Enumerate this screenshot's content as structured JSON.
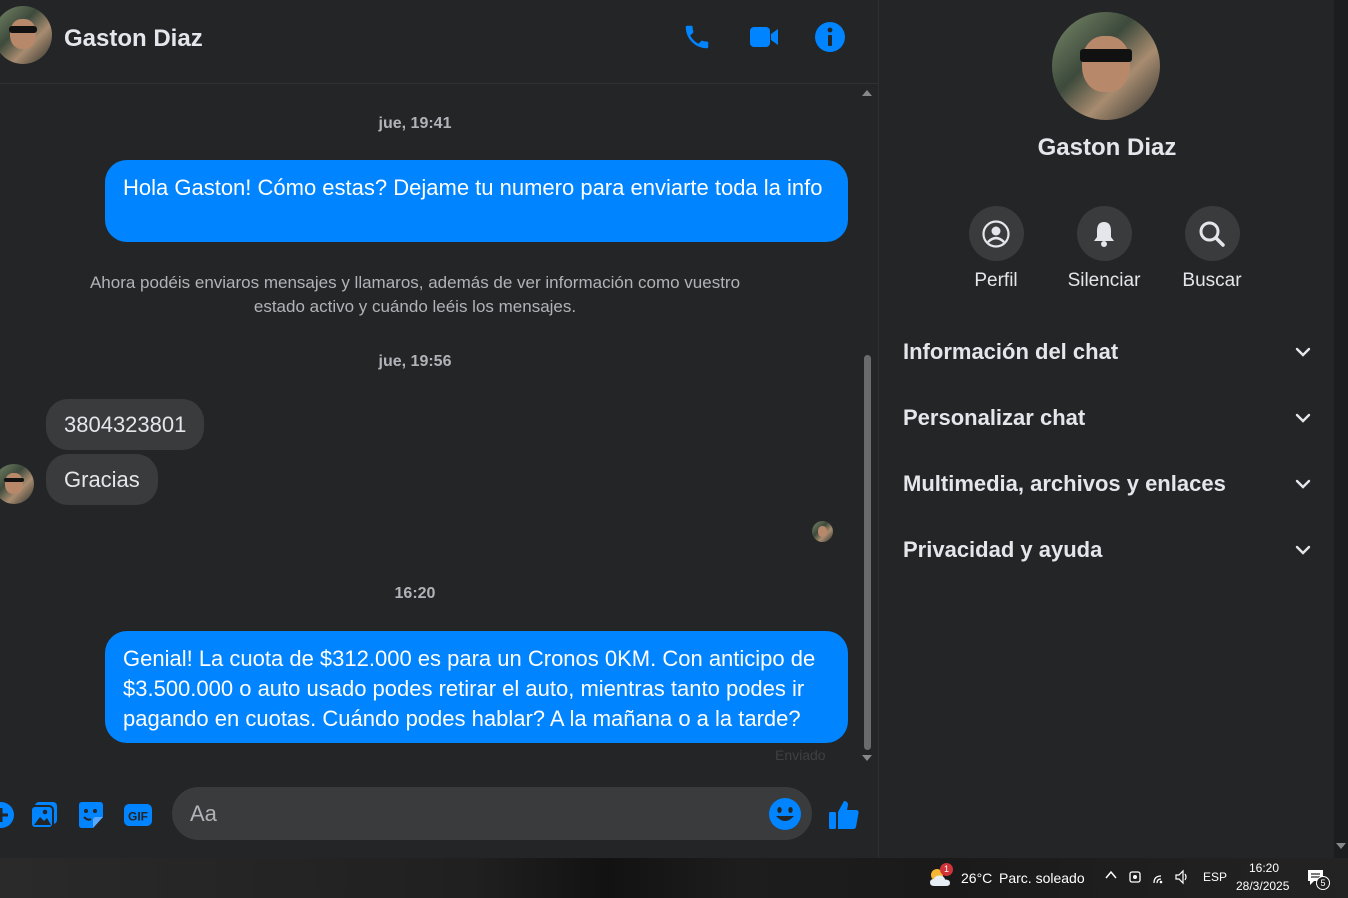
{
  "header": {
    "name": "Gaston Diaz"
  },
  "messages": {
    "ts1": "jue, 19:41",
    "out1": "Hola Gaston! Cómo estas? Dejame tu numero para enviarte toda la info",
    "system_note": "Ahora podéis enviaros mensajes y llamaros, además de ver información como vuestro estado activo y cuándo leéis los mensajes.",
    "ts2": "jue, 19:56",
    "in1": "3804323801",
    "in2": "Gracias",
    "ts3": "16:20",
    "out2": "Genial! La cuota de $312.000 es para un Cronos 0KM. Con anticipo de $3.500.000 o auto usado podes retirar el auto, mientras tanto podes ir pagando en cuotas. Cuándo podes hablar? A la mañana o a la tarde?",
    "status": "Enviado"
  },
  "composer": {
    "placeholder": "Aa"
  },
  "panel": {
    "name": "Gaston Diaz",
    "actions": [
      {
        "label": "Perfil",
        "icon": "profile-icon"
      },
      {
        "label": "Silenciar",
        "icon": "bell-icon"
      },
      {
        "label": "Buscar",
        "icon": "search-icon"
      }
    ],
    "sections": [
      {
        "title": "Información del chat"
      },
      {
        "title": "Personalizar chat"
      },
      {
        "title": "Multimedia, archivos y enlaces"
      },
      {
        "title": "Privacidad y ayuda"
      }
    ]
  },
  "taskbar": {
    "weather_badge": "1",
    "temperature": "26°C",
    "weather": "Parc. soleado",
    "language": "ESP",
    "time": "16:20",
    "date": "28/3/2025",
    "notifications": "5"
  },
  "colors": {
    "accent": "#0084ff",
    "background": "#242526",
    "bubble_in": "#3a3b3c"
  }
}
